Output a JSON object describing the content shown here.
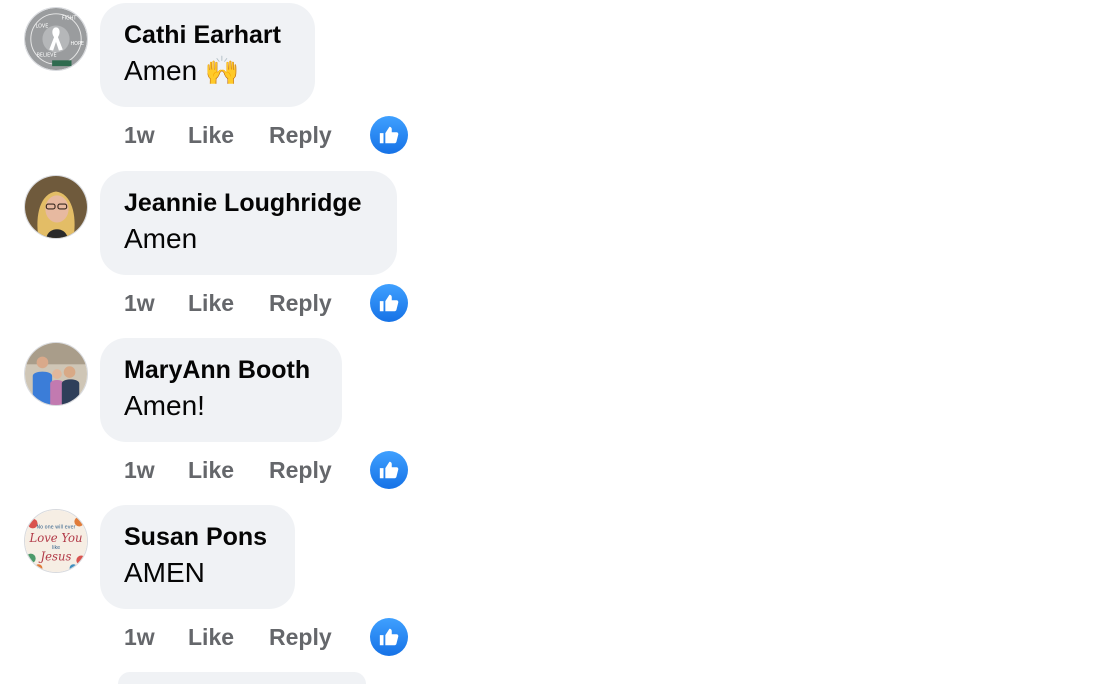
{
  "comments": [
    {
      "name": "Cathi Earhart",
      "text": "Amen 🙌",
      "time": "1w",
      "like_label": "Like",
      "reply_label": "Reply",
      "reaction": "like-icon"
    },
    {
      "name": "Jeannie Loughridge",
      "text": "Amen",
      "time": "1w",
      "like_label": "Like",
      "reply_label": "Reply",
      "reaction": "like-icon"
    },
    {
      "name": "MaryAnn Booth",
      "text": "Amen!",
      "time": "1w",
      "like_label": "Like",
      "reply_label": "Reply",
      "reaction": "like-icon"
    },
    {
      "name": "Susan Pons",
      "text": "AMEN",
      "time": "1w",
      "like_label": "Like",
      "reply_label": "Reply",
      "reaction": "like-icon"
    }
  ],
  "avatar_badge_words": [
    "LOVE",
    "FIGHT",
    "HOPE",
    "BELIEVE"
  ],
  "avatar_sticker_text": [
    "No one will ever",
    "Love You",
    "like",
    "Jesus"
  ],
  "colors": {
    "bubble": "#f0f2f5",
    "name": "#050505",
    "meta": "#65676b",
    "like_blue": "#1877f2"
  }
}
